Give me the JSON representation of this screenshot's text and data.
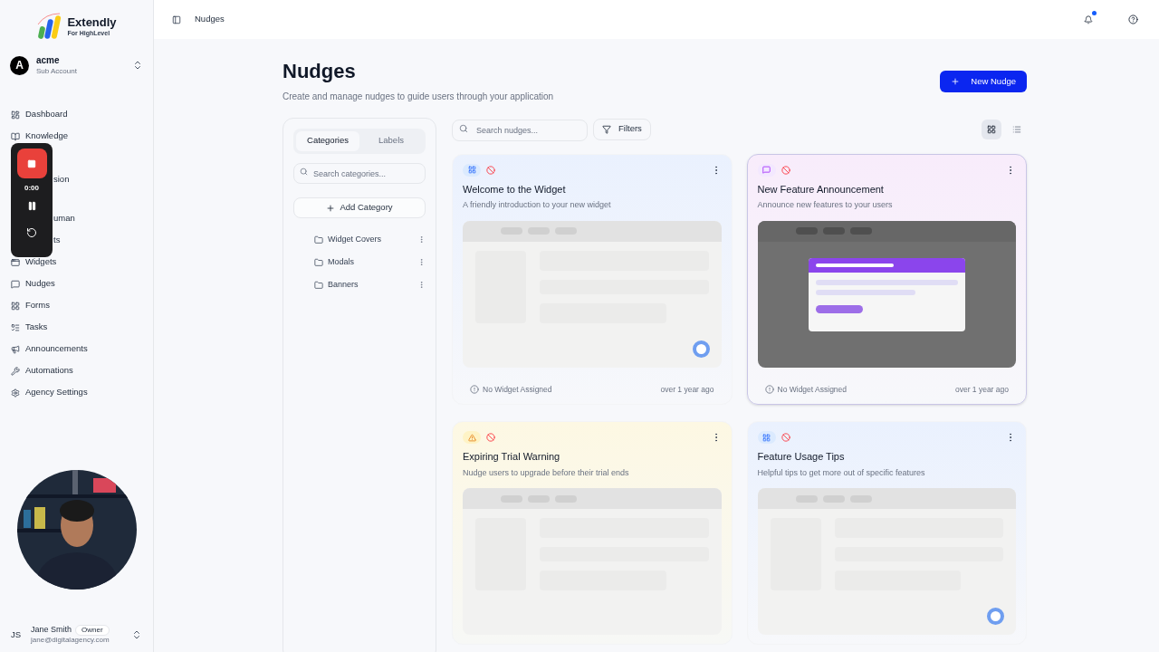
{
  "brand": {
    "name": "Extendly",
    "tagline": "For HighLevel"
  },
  "account": {
    "initial": "A",
    "name": "acme",
    "type": "Sub Account"
  },
  "sidebar": {
    "items": [
      {
        "kind": "full",
        "label": "Dashboard",
        "selected": false
      },
      {
        "kind": "full",
        "label": "Knowledge",
        "selected": false
      },
      {
        "kind": "partial",
        "label": "sion"
      },
      {
        "kind": "partial",
        "label": "uman"
      },
      {
        "kind": "partial",
        "label": "ts"
      },
      {
        "kind": "full",
        "label": "Widgets",
        "selected": false
      },
      {
        "kind": "full",
        "label": "Nudges",
        "selected": false
      },
      {
        "kind": "full",
        "label": "Forms",
        "selected": false
      },
      {
        "kind": "full",
        "label": "Tasks",
        "selected": false
      },
      {
        "kind": "full",
        "label": "Announcements",
        "selected": false
      },
      {
        "kind": "full",
        "label": "Automations",
        "selected": false
      },
      {
        "kind": "full",
        "label": "Agency Settings",
        "selected": false
      }
    ]
  },
  "recorder": {
    "time": "0:00"
  },
  "user": {
    "initials": "JS",
    "name": "Jane Smith",
    "role": "Owner",
    "email": "jane@digitalagency.com"
  },
  "header": {
    "breadcrumb": "Nudges",
    "notification_dot": true
  },
  "page": {
    "title": "Nudges",
    "subtitle": "Create and manage nudges to guide users through your application",
    "new_button": "New Nudge"
  },
  "categories_panel": {
    "tabs": [
      {
        "label": "Categories",
        "selected": true
      },
      {
        "label": "Labels",
        "selected": false
      }
    ],
    "search": {
      "placeholder": "Search categories..."
    },
    "add_button": "Add Category",
    "items": [
      "Widget Covers",
      "Modals",
      "Banners"
    ]
  },
  "toolbar": {
    "search": {
      "placeholder": "Search nudges..."
    },
    "filters": "Filters",
    "views": [
      {
        "kind": "grid",
        "selected": true
      },
      {
        "kind": "list",
        "selected": false
      }
    ]
  },
  "cards": [
    {
      "kind": "widget",
      "title": "Welcome to the Widget",
      "description": "A friendly introduction to your new widget",
      "preview": {
        "kind": "skeleton",
        "launcher": true
      },
      "selected": false,
      "footer": {
        "assignment": "No Widget Assigned",
        "time": "over 1 year ago"
      }
    },
    {
      "kind": "message",
      "title": "New Feature Announcement",
      "description": "Announce new features to your users",
      "preview": {
        "kind": "modal"
      },
      "selected": true,
      "footer": {
        "assignment": "No Widget Assigned",
        "time": "over 1 year ago"
      }
    },
    {
      "kind": "warning",
      "title": "Expiring Trial Warning",
      "description": "Nudge users to upgrade before their trial ends",
      "preview": {
        "kind": "skeleton",
        "launcher": false
      },
      "selected": false
    },
    {
      "kind": "widget",
      "title": "Feature Usage Tips",
      "description": "Helpful tips to get more out of specific features",
      "preview": {
        "kind": "skeleton",
        "launcher": true
      },
      "selected": false
    }
  ]
}
